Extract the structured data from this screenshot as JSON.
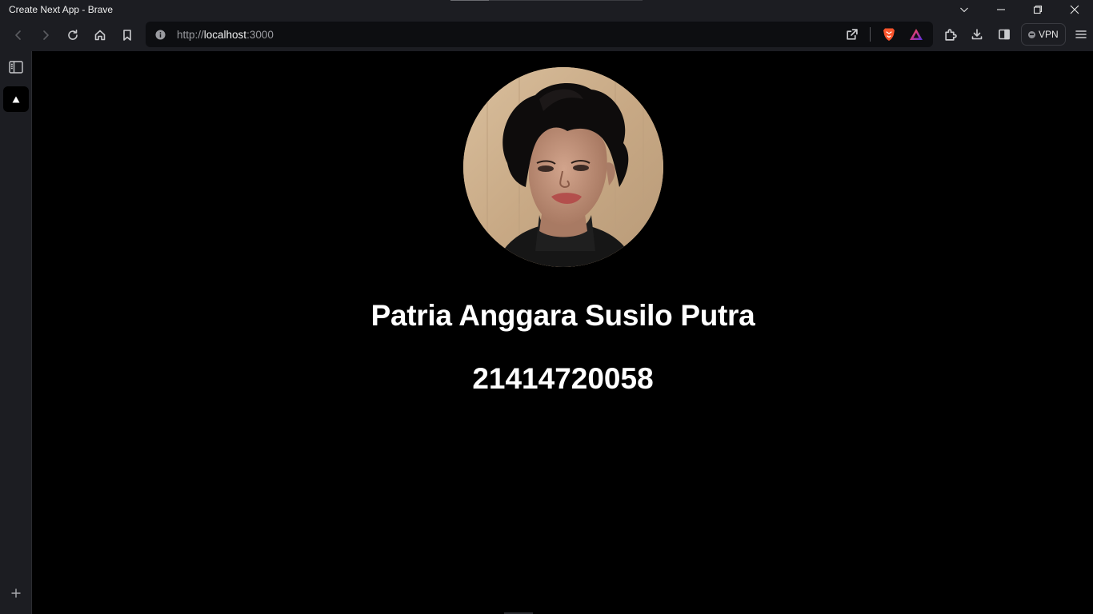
{
  "window": {
    "title": "Create Next App - Brave"
  },
  "toolbar": {
    "url_scheme": "http://",
    "url_host": "localhost",
    "url_port": ":3000",
    "vpn_label": "VPN"
  },
  "icons": {
    "back": "back-arrow-icon",
    "forward": "forward-arrow-icon",
    "reload": "reload-icon",
    "home": "home-icon",
    "bookmark": "bookmark-icon",
    "site_info": "info-icon",
    "share": "share-icon",
    "brave_shields": "brave-lion-icon",
    "rewards": "brave-rewards-triangle-icon",
    "extensions": "puzzle-icon",
    "downloads": "download-icon",
    "sidebar_toggle": "sidebar-icon",
    "menu": "hamburger-menu-icon"
  },
  "colors": {
    "chrome_bg": "#1c1d22",
    "page_bg": "#000000",
    "text": "#ffffff",
    "brave_orange": "#fb542b"
  },
  "profile": {
    "name": "Patria Anggara Susilo Putra",
    "id_number": "21414720058"
  }
}
